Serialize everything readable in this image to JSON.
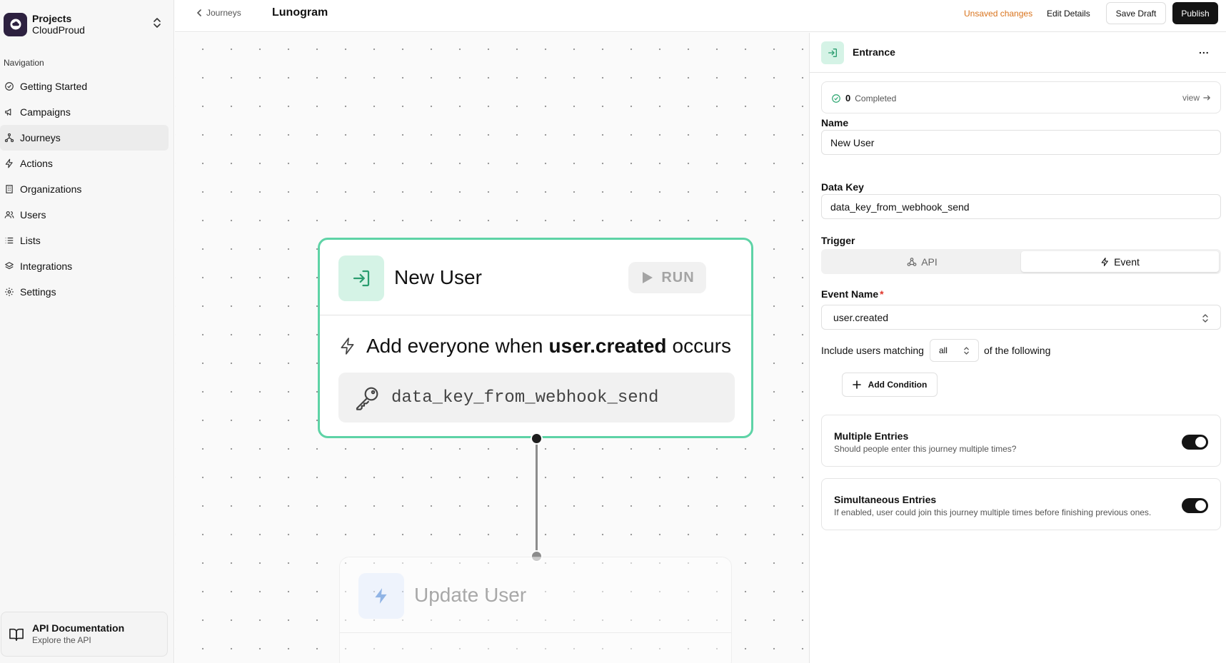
{
  "sidebar": {
    "project_label": "Projects",
    "project_name": "CloudProud",
    "nav_heading": "Navigation",
    "items": [
      {
        "label": "Getting Started",
        "icon": "check-circle-icon"
      },
      {
        "label": "Campaigns",
        "icon": "megaphone-icon"
      },
      {
        "label": "Journeys",
        "icon": "workflow-icon",
        "active": true
      },
      {
        "label": "Actions",
        "icon": "bolt-icon"
      },
      {
        "label": "Organizations",
        "icon": "building-icon"
      },
      {
        "label": "Users",
        "icon": "users-icon"
      },
      {
        "label": "Lists",
        "icon": "list-icon"
      },
      {
        "label": "Integrations",
        "icon": "layers-icon"
      },
      {
        "label": "Settings",
        "icon": "gear-icon"
      }
    ],
    "api_doc": {
      "title": "API Documentation",
      "subtitle": "Explore the API"
    }
  },
  "topbar": {
    "breadcrumb": "Journeys",
    "title": "Lunogram",
    "unsaved": "Unsaved changes",
    "edit_details": "Edit Details",
    "save_draft": "Save Draft",
    "publish": "Publish"
  },
  "canvas": {
    "entrance_node": {
      "title": "New User",
      "run_label": "RUN",
      "trigger_prefix": "Add everyone when",
      "trigger_event": "user.created",
      "trigger_suffix": "occurs",
      "data_key": "data_key_from_webhook_send"
    },
    "next_node": {
      "title": "Update User"
    }
  },
  "panel": {
    "title": "Entrance",
    "more": "...",
    "completed_count": "0",
    "completed_label": "Completed",
    "view_label": "view",
    "name_label": "Name",
    "name_value": "New User",
    "data_key_label": "Data Key",
    "data_key_value": "data_key_from_webhook_send",
    "trigger_label": "Trigger",
    "trigger_options": [
      "API",
      "Event"
    ],
    "trigger_selected": "Event",
    "event_name_label": "Event Name",
    "event_required_mark": "*",
    "event_name_value": "user.created",
    "include_prefix": "Include users matching",
    "match_value": "all",
    "include_suffix": "of the following",
    "add_condition": "Add Condition",
    "multiple_entries": {
      "title": "Multiple Entries",
      "desc": "Should people enter this journey multiple times?",
      "enabled": true
    },
    "simultaneous_entries": {
      "title": "Simultaneous Entries",
      "desc": "If enabled, user could join this journey multiple times before finishing previous ones.",
      "enabled": true
    }
  },
  "colors": {
    "accent_green": "#5ed3a6",
    "warning_orange": "#d9731c",
    "primary_dark": "#141414"
  }
}
